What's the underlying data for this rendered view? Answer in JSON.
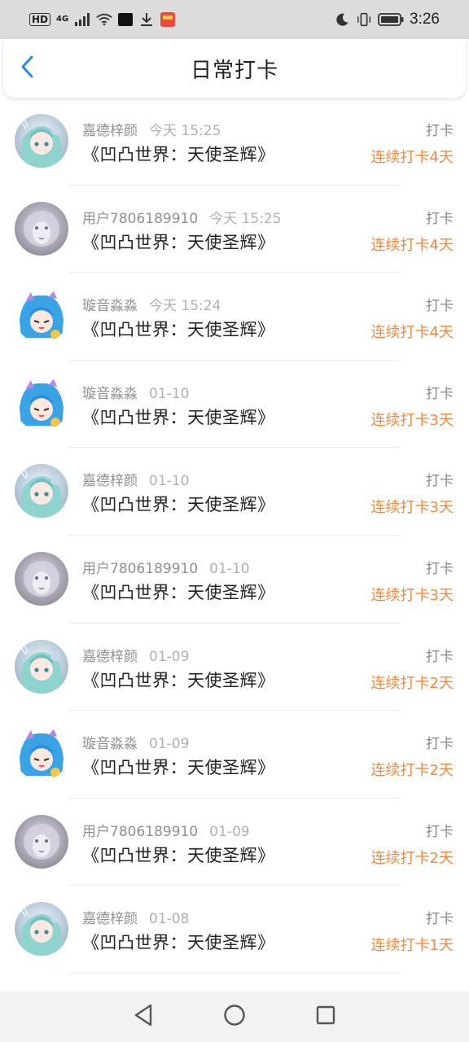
{
  "status_bar": {
    "hd": "HD",
    "network": "4G",
    "time": "3:26"
  },
  "header": {
    "title": "日常打卡",
    "back_icon": "chevron-left-icon",
    "accent_color": "#2b8be8"
  },
  "checkins": [
    {
      "name": "嘉德梓颜",
      "time": "今天 15:25",
      "game": "《凹凸世界：天使圣辉》",
      "tag": "打卡",
      "streak": "连续打卡4天",
      "avatar": "anime-girl-teal"
    },
    {
      "name": "用户7806189910",
      "time": "今天 15:25",
      "game": "《凹凸世界：天使圣辉》",
      "tag": "打卡",
      "streak": "连续打卡4天",
      "avatar": "white-lion"
    },
    {
      "name": "璇音淼淼",
      "time": "今天 15:24",
      "game": "《凹凸世界：天使圣辉》",
      "tag": "打卡",
      "streak": "连续打卡4天",
      "avatar": "anime-girl-blue"
    },
    {
      "name": "璇音淼淼",
      "time": "01-10",
      "game": "《凹凸世界：天使圣辉》",
      "tag": "打卡",
      "streak": "连续打卡3天",
      "avatar": "anime-girl-blue"
    },
    {
      "name": "嘉德梓颜",
      "time": "01-10",
      "game": "《凹凸世界：天使圣辉》",
      "tag": "打卡",
      "streak": "连续打卡3天",
      "avatar": "anime-girl-teal"
    },
    {
      "name": "用户7806189910",
      "time": "01-10",
      "game": "《凹凸世界：天使圣辉》",
      "tag": "打卡",
      "streak": "连续打卡3天",
      "avatar": "white-lion"
    },
    {
      "name": "嘉德梓颜",
      "time": "01-09",
      "game": "《凹凸世界：天使圣辉》",
      "tag": "打卡",
      "streak": "连续打卡2天",
      "avatar": "anime-girl-teal"
    },
    {
      "name": "璇音淼淼",
      "time": "01-09",
      "game": "《凹凸世界：天使圣辉》",
      "tag": "打卡",
      "streak": "连续打卡2天",
      "avatar": "anime-girl-blue"
    },
    {
      "name": "用户7806189910",
      "time": "01-09",
      "game": "《凹凸世界：天使圣辉》",
      "tag": "打卡",
      "streak": "连续打卡2天",
      "avatar": "white-lion"
    },
    {
      "name": "嘉德梓颜",
      "time": "01-08",
      "game": "《凹凸世界：天使圣辉》",
      "tag": "打卡",
      "streak": "连续打卡1天",
      "avatar": "anime-girl-teal"
    }
  ],
  "colors": {
    "streak": "#f08a42",
    "meta_text": "#999999",
    "title_text": "#222222"
  },
  "nav_bar": {
    "back": "triangle-back-icon",
    "home": "circle-home-icon",
    "recents": "square-recents-icon"
  }
}
